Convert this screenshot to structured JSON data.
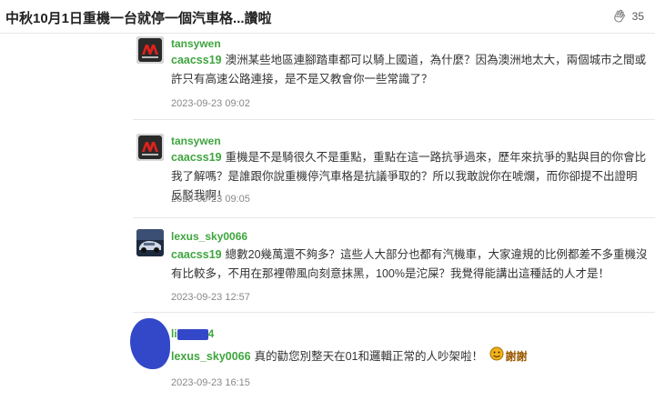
{
  "header": {
    "title": "中秋10月1日重機一台就停一個汽車格...讚啦",
    "clap_count": "35"
  },
  "replies": [
    {
      "author": "tansywen",
      "mention": "caacss19",
      "text": "澳洲某些地區連腳踏車都可以騎上國道，為什麼？因為澳洲地太大，兩個城市之間或許只有高速公路連接，是不是又教會你一些常識了？",
      "time": "2023-09-23 09:02"
    },
    {
      "author": "tansywen",
      "mention": "caacss19",
      "text": "重機是不是騎很久不是重點，重點在這一路抗爭過來，歷年來抗爭的點與目的你會比我了解嗎？是誰跟你說重機停汽車格是抗議爭取的？所以我敢說你在唬爛，而你卻提不出證明反駁我啊！",
      "time": "2023-09-23 09:05"
    },
    {
      "author": "lexus_sky0066",
      "mention": "caacss19",
      "text": "總數20幾萬還不夠多？這些人大部分也都有汽機車，大家違規的比例都差不多重機沒有比較多，不用在那裡帶風向刻意抹黑，100%是沱屎？我覺得能講出這種話的人才是！",
      "time": "2023-09-23 12:57"
    },
    {
      "author": "li",
      "author_tail": "4",
      "mention": "lexus_sky0066",
      "text": "真的勸您別整天在01和邏輯正常的人吵架啦！",
      "emote_label": "謝謝",
      "time": "2023-09-23 16:15"
    }
  ]
}
